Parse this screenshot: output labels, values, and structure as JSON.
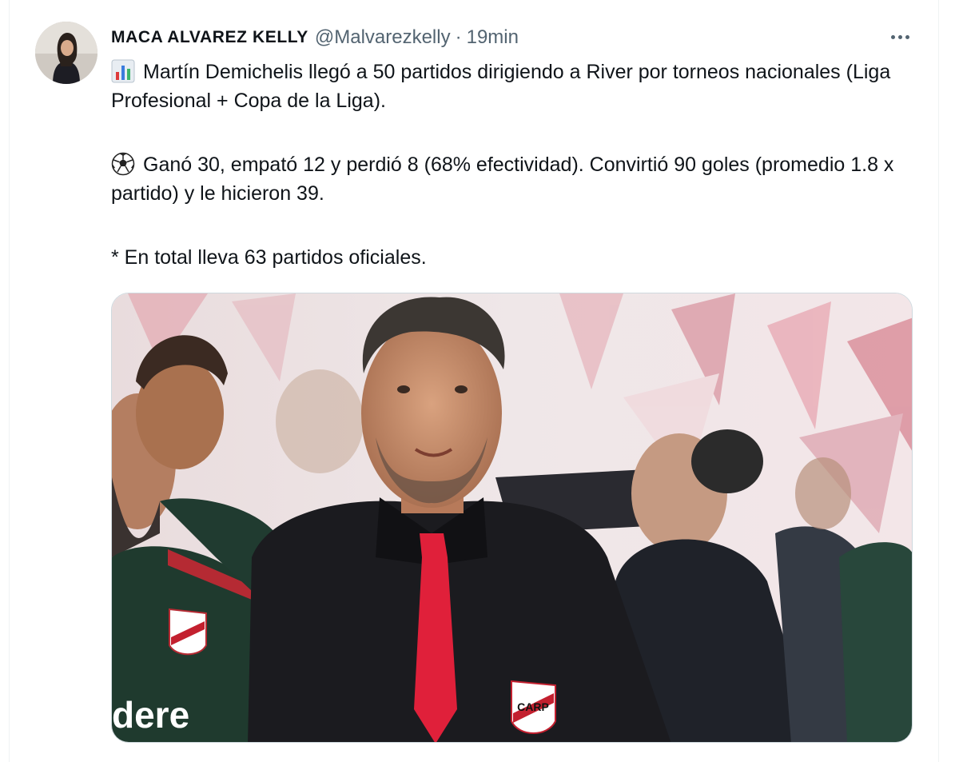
{
  "tweet": {
    "author_name": "MACA ALVAREZ KELLY",
    "author_handle": "@Malvarezkelly",
    "separator": "·",
    "timestamp": "19min",
    "lines": [
      "Martín Demichelis llegó a 50 partidos dirigiendo a River por torneos nacionales (Liga Profesional + Copa de la Liga).",
      "Ganó 30, empató 12 y perdió 8 (68% efectividad). Convirtió 90 goles (promedio 1.8 x partido) y le hicieron 39.",
      "* En total lleva 63 partidos oficiales."
    ],
    "icons": {
      "line1": "bar-chart-icon",
      "line2": "soccer-ball-icon",
      "more": "more-options-icon"
    },
    "media": {
      "sponsor_text": "dere",
      "badge_text": "CARP"
    }
  },
  "colors": {
    "text_primary": "#0f1419",
    "text_secondary": "#536471",
    "tie_red": "#e0203a",
    "jersey_green": "#1f3a2e"
  }
}
